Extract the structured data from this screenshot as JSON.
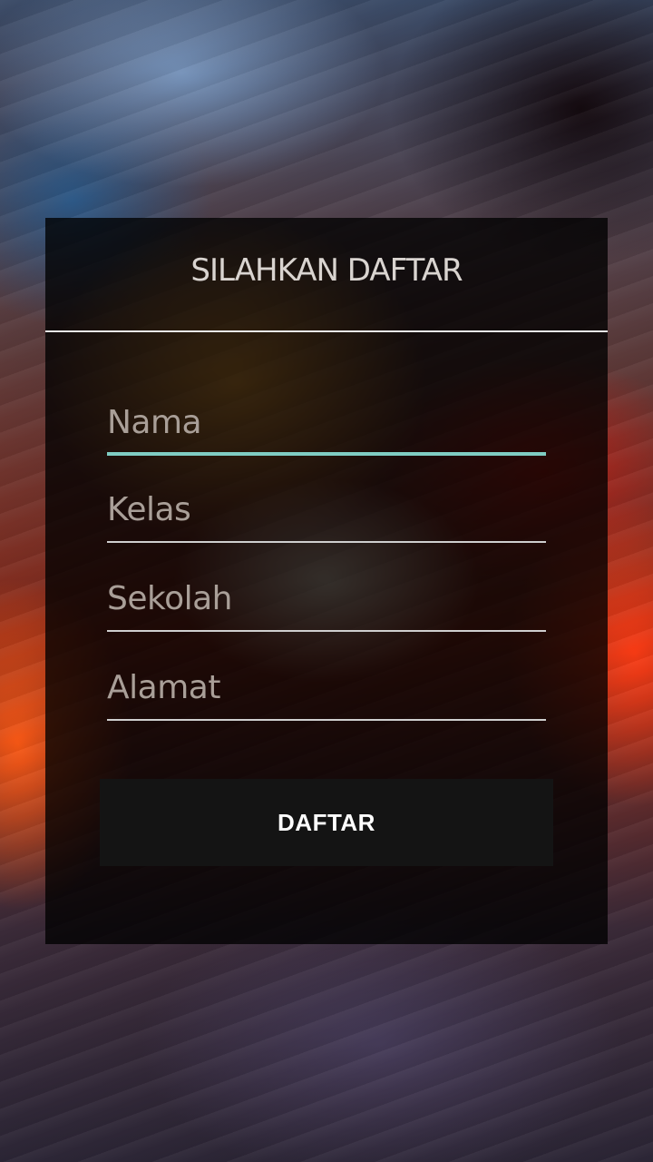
{
  "form": {
    "title": "SILAHKAN DAFTAR",
    "fields": [
      {
        "placeholder": "Nama",
        "value": "",
        "active": true
      },
      {
        "placeholder": "Kelas",
        "value": ""
      },
      {
        "placeholder": "Sekolah",
        "value": ""
      },
      {
        "placeholder": "Alamat",
        "value": ""
      }
    ],
    "submit_label": "DAFTAR"
  },
  "colors": {
    "accent": "#7fcdc3",
    "card_background": "rgba(0,0,0,0.78)",
    "button_background": "#141414"
  }
}
